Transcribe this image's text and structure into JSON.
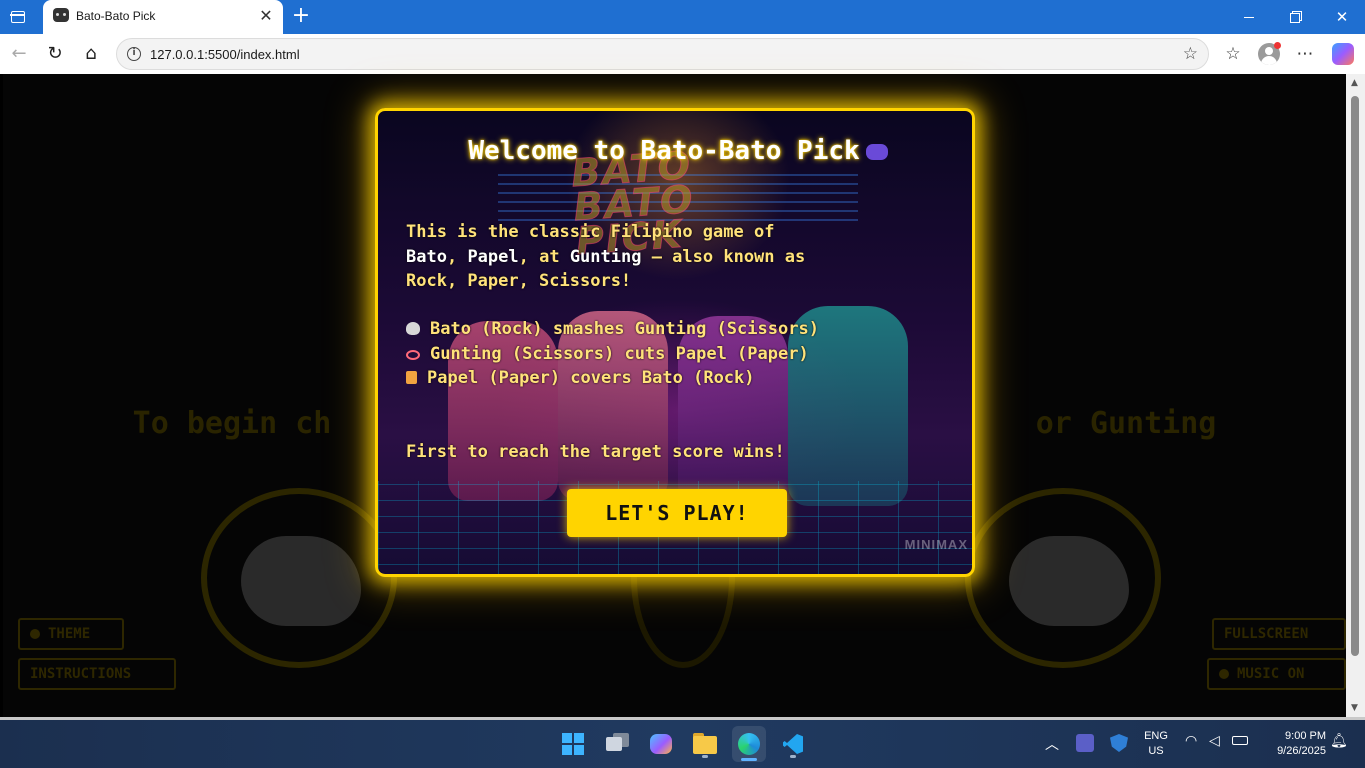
{
  "browser": {
    "tab_title": "Bato-Bato Pick",
    "tab_close": "✕",
    "new_tab": "+",
    "url": "127.0.0.1:5500/index.html",
    "nav_back": "←",
    "nav_reload": "↻",
    "nav_home": "⌂",
    "favorite": "☆",
    "favorites": "☆",
    "more": "⋯",
    "info": "i",
    "window_close": "✕"
  },
  "page": {
    "title": "Bato-Bato Pick",
    "instruction_visible": "To begin ch                                       or Gunting",
    "buttons": {
      "theme": "THEME",
      "instructions": "INSTRUCTIONS",
      "fullscreen": "FULLSCREEN",
      "music": "MUSIC ON"
    }
  },
  "modal": {
    "title": "Welcome to Bato-Bato Pick",
    "intro_1": "This is the classic Filipino game of",
    "intro_bato": "Bato",
    "intro_papel": "Papel",
    "intro_at": ", at ",
    "intro_gunting": "Gunting",
    "intro_2": " — also known as",
    "intro_3": "Rock, Paper, Scissors!",
    "rules": [
      "Bato (Rock) smashes Gunting (Scissors)",
      "Gunting (Scissors) cuts Papel (Paper)",
      "Papel (Paper) covers Bato (Rock)"
    ],
    "target_text": "First to reach the target score wins!",
    "play_button": "LET'S PLAY!",
    "art_logo_lines": [
      "BATO",
      "BATO",
      "PICK"
    ],
    "watermark": "MINIMAX"
  },
  "taskbar": {
    "lang_1": "ENG",
    "lang_2": "US",
    "time": "9:00 PM",
    "date": "9/26/2025"
  },
  "colors": {
    "accent": "#ffd400",
    "modal_text": "#ffe27a",
    "browser_chrome": "#1f6fd1"
  }
}
